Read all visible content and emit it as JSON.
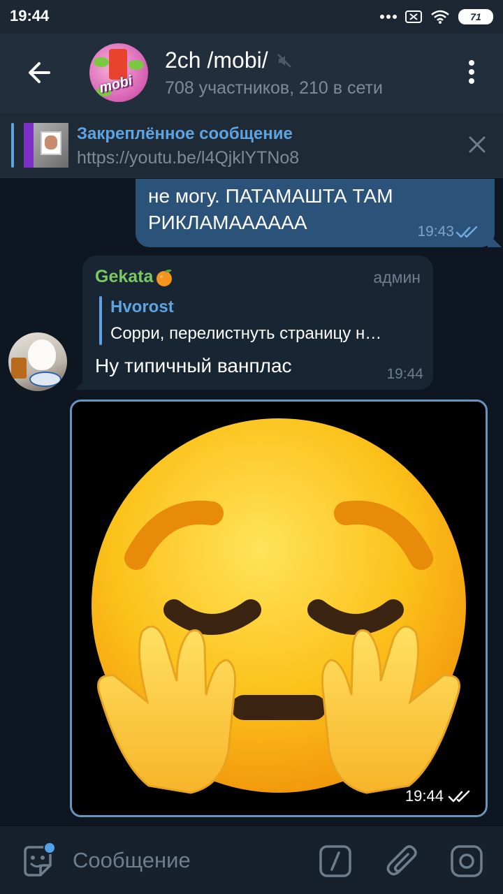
{
  "status_bar": {
    "time": "19:44",
    "battery": "71",
    "icons": [
      "dots-icon",
      "sim-off-icon",
      "wifi-icon",
      "battery-icon"
    ]
  },
  "header": {
    "title": "2ch /mobi/",
    "subtitle": "708 участников, 210 в сети",
    "avatar_text": "mobi",
    "muted": true
  },
  "pinned": {
    "title": "Закреплённое сообщение",
    "text": "https://youtu.be/l4QjklYTNo8"
  },
  "messages": {
    "outgoing": {
      "text": "не могу. ПАТАМАШТА ТАМ\nРИКЛАМАААААА",
      "time": "19:43"
    },
    "incoming": {
      "author": "Gekata",
      "role": "админ",
      "reply_author": "Hvorost",
      "reply_text": "Сорри, перелистнуть страницу н…",
      "text": "Ну типичный ванплас",
      "time": "19:44"
    },
    "sticker": {
      "emoji": "pleading-face-hands-icon",
      "time": "19:44"
    }
  },
  "input": {
    "placeholder": "Сообщение"
  },
  "colors": {
    "accent": "#5ea4e0",
    "outgoing_bubble": "#2b5278",
    "incoming_bubble": "#182533",
    "author_name": "#7bc862",
    "header_bg": "#232e3c",
    "chat_bg": "#0e1621"
  }
}
